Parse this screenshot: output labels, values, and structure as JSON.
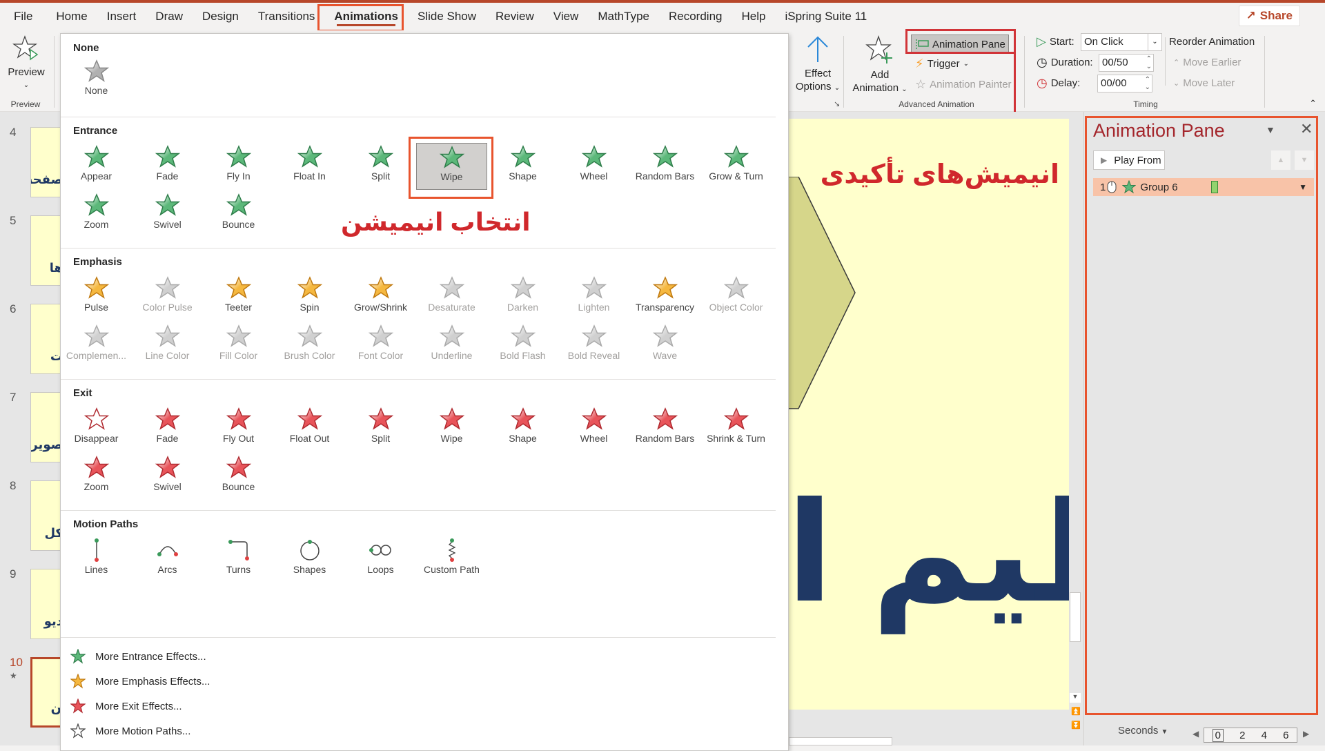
{
  "tabs": [
    "File",
    "Home",
    "Insert",
    "Draw",
    "Design",
    "Transitions",
    "Animations",
    "Slide Show",
    "Review",
    "View",
    "MathType",
    "Recording",
    "Help",
    "iSpring Suite 11"
  ],
  "active_tab": "Animations",
  "share_label": "Share",
  "ribbon": {
    "preview": {
      "label": "Preview",
      "group": "Preview"
    },
    "effect_options": {
      "line1": "Effect",
      "line2": "Options"
    },
    "add_animation": {
      "line1": "Add",
      "line2": "Animation"
    },
    "animation_pane": "Animation Pane",
    "trigger": "Trigger",
    "animation_painter": "Animation Painter",
    "advanced_group": "Advanced Animation",
    "start_label": "Start:",
    "start_value": "On Click",
    "duration_label": "Duration:",
    "duration_value": "00/50",
    "delay_label": "Delay:",
    "delay_value": "00/00",
    "reorder_title": "Reorder Animation",
    "move_earlier": "Move Earlier",
    "move_later": "Move Later",
    "timing_group": "Timing"
  },
  "gallery": {
    "none": {
      "title": "None",
      "items": [
        {
          "label": "None"
        }
      ]
    },
    "entrance": {
      "title": "Entrance",
      "items": [
        {
          "label": "Appear"
        },
        {
          "label": "Fade"
        },
        {
          "label": "Fly In"
        },
        {
          "label": "Float In"
        },
        {
          "label": "Split"
        },
        {
          "label": "Wipe",
          "selected": true
        },
        {
          "label": "Shape"
        },
        {
          "label": "Wheel"
        },
        {
          "label": "Random Bars"
        },
        {
          "label": "Grow & Turn"
        },
        {
          "label": "Zoom"
        },
        {
          "label": "Swivel"
        },
        {
          "label": "Bounce"
        }
      ]
    },
    "emphasis": {
      "title": "Emphasis",
      "items": [
        {
          "label": "Pulse"
        },
        {
          "label": "Color Pulse",
          "dim": true
        },
        {
          "label": "Teeter"
        },
        {
          "label": "Spin"
        },
        {
          "label": "Grow/Shrink"
        },
        {
          "label": "Desaturate",
          "dim": true
        },
        {
          "label": "Darken",
          "dim": true
        },
        {
          "label": "Lighten",
          "dim": true
        },
        {
          "label": "Transparency"
        },
        {
          "label": "Object Color",
          "dim": true
        },
        {
          "label": "Complemen...",
          "dim": true
        },
        {
          "label": "Line Color",
          "dim": true
        },
        {
          "label": "Fill Color",
          "dim": true
        },
        {
          "label": "Brush Color",
          "dim": true
        },
        {
          "label": "Font Color",
          "dim": true
        },
        {
          "label": "Underline",
          "dim": true
        },
        {
          "label": "Bold Flash",
          "dim": true
        },
        {
          "label": "Bold Reveal",
          "dim": true
        },
        {
          "label": "Wave",
          "dim": true
        }
      ]
    },
    "exit": {
      "title": "Exit",
      "items": [
        {
          "label": "Disappear"
        },
        {
          "label": "Fade"
        },
        {
          "label": "Fly Out"
        },
        {
          "label": "Float Out"
        },
        {
          "label": "Split"
        },
        {
          "label": "Wipe"
        },
        {
          "label": "Shape"
        },
        {
          "label": "Wheel"
        },
        {
          "label": "Random Bars"
        },
        {
          "label": "Shrink & Turn"
        },
        {
          "label": "Zoom"
        },
        {
          "label": "Swivel"
        },
        {
          "label": "Bounce"
        }
      ]
    },
    "motion": {
      "title": "Motion Paths",
      "items": [
        {
          "label": "Lines"
        },
        {
          "label": "Arcs"
        },
        {
          "label": "Turns"
        },
        {
          "label": "Shapes"
        },
        {
          "label": "Loops"
        },
        {
          "label": "Custom Path"
        }
      ]
    },
    "more": [
      {
        "label": "More Entrance Effects...",
        "icon": "entrance"
      },
      {
        "label": "More Emphasis Effects...",
        "icon": "emphasis"
      },
      {
        "label": "More Exit Effects...",
        "icon": "exit"
      },
      {
        "label": "More Motion Paths...",
        "icon": "motion"
      }
    ],
    "annotation": "انتخاب انیمیشن"
  },
  "thumbnails": [
    {
      "num": "4",
      "text": "صفحه"
    },
    {
      "num": "5",
      "text": "ها"
    },
    {
      "num": "6",
      "text": "ت"
    },
    {
      "num": "7",
      "text": "صویر"
    },
    {
      "num": "8",
      "text": "کل"
    },
    {
      "num": "9",
      "text": "دیو"
    },
    {
      "num": "10",
      "text": "ن",
      "active": true
    }
  ],
  "slide": {
    "title": "انیمیش‌های تأکیدی",
    "big_text": "ظیم ا"
  },
  "animation_pane": {
    "title": "Animation Pane",
    "play_from": "Play From",
    "items": [
      {
        "index": "1",
        "name": "Group 6"
      }
    ],
    "seconds_label": "Seconds",
    "timeline_ticks": [
      "0",
      "2",
      "4",
      "6"
    ]
  },
  "colors": {
    "accent": "#b7472a",
    "highlight_outline": "#e8542e",
    "entrance_green": "#5cb87a",
    "emphasis_orange": "#f5b840",
    "exit_red": "#e8545a",
    "slide_bg": "#ffffcc",
    "slide_title": "#d0282c",
    "slide_text": "#1f3864"
  }
}
